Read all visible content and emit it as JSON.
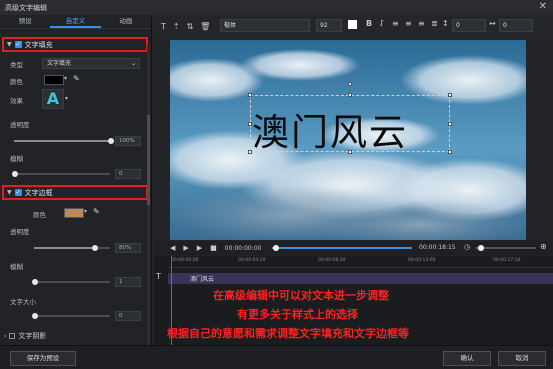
{
  "window": {
    "title": "高级文字编辑",
    "close_icon": "close-icon"
  },
  "tabs": [
    "预设",
    "自定义",
    "动画"
  ],
  "active_tab": 1,
  "fill_section": {
    "title": "文字填充",
    "type_label": "类型",
    "type_value": "文字填充",
    "color_label": "颜色",
    "color_value": "#000000",
    "effect_label": "效果",
    "effect_glyph": "A",
    "opacity_label": "透明度",
    "opacity_value": "100%",
    "blur_label": "模糊",
    "blur_value": "0"
  },
  "border_section": {
    "title": "文字边框",
    "color_label": "颜色",
    "color_value": "#b8895a",
    "opacity_label": "透明度",
    "opacity_value": "80%",
    "blur_label": "模糊",
    "blur_value": "1",
    "size_label": "文字大小",
    "size_value": "0"
  },
  "shadow_section": {
    "title": "文字阴影"
  },
  "toolbar": {
    "font_name": "楷体",
    "font_size": "92",
    "spacing1": "0",
    "spacing2": "0",
    "bold": "B",
    "italic": "I"
  },
  "canvas": {
    "text": "澳门风云"
  },
  "playback": {
    "time_current": "00:00:00:00",
    "time_total": "00:00:18:15"
  },
  "timeline": {
    "ruler_ticks": [
      "00:00:00:00",
      "00:00:04:20",
      "00:00:08:20",
      "00:00:13:00",
      "00:00:17:10"
    ],
    "clip_label": "澳门风云"
  },
  "annotations": [
    "在高级编辑中可以对文本进一步调整",
    "有更多关于样式上的选择",
    "根据自己的意愿和需求调整文字填充和文字边框等"
  ],
  "footer": {
    "save_preset": "保存为预设",
    "ok": "确认",
    "cancel": "取消"
  },
  "colors": {
    "accent": "#3a8fe0",
    "highlight": "#e02020",
    "annotation": "#ff2020"
  }
}
